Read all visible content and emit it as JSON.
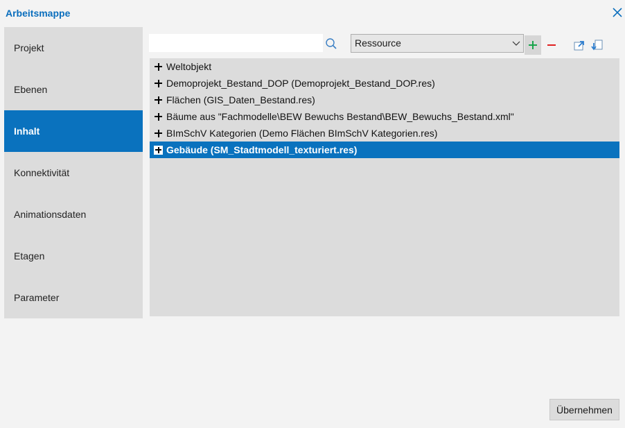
{
  "dialog": {
    "title": "Arbeitsmappe"
  },
  "sidebar": {
    "items": [
      {
        "label": "Projekt"
      },
      {
        "label": "Ebenen"
      },
      {
        "label": "Inhalt"
      },
      {
        "label": "Konnektivität"
      },
      {
        "label": "Animationsdaten"
      },
      {
        "label": "Etagen"
      },
      {
        "label": "Parameter"
      }
    ],
    "active_index": 2
  },
  "toolbar": {
    "search_value": "",
    "resource_select_value": "Ressource",
    "icons": [
      "search-icon",
      "chevron-down-icon",
      "plus-icon",
      "minus-icon",
      "import-icon",
      "export-icon"
    ]
  },
  "tree": {
    "items": [
      {
        "label": "Weltobjekt"
      },
      {
        "label": "Demoprojekt_Bestand_DOP (Demoprojekt_Bestand_DOP.res)"
      },
      {
        "label": "Flächen (GIS_Daten_Bestand.res)"
      },
      {
        "label": "Bäume aus \"Fachmodelle\\BEW Bewuchs Bestand\\BEW_Bewuchs_Bestand.xml\""
      },
      {
        "label": "BImSchV Kategorien (Demo Flächen BImSchV Kategorien.res)"
      },
      {
        "label": "Gebäude (SM_Stadtmodell_texturiert.res)"
      }
    ],
    "selected_index": 5
  },
  "footer": {
    "apply_label": "Übernehmen"
  },
  "colors": {
    "accent": "#0a72be",
    "title": "#0a6ebd",
    "add": "#17a34a",
    "remove": "#e02020"
  }
}
